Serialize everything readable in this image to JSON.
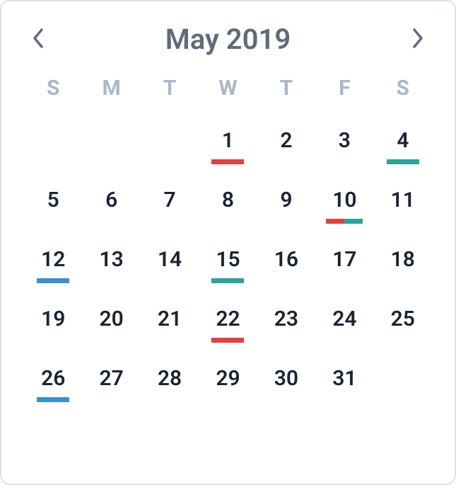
{
  "header": {
    "title": "May 2019"
  },
  "weekdays": [
    "S",
    "M",
    "T",
    "W",
    "T",
    "F",
    "S"
  ],
  "colors": {
    "red": "#e83e3e",
    "teal": "#26a69a",
    "blue": "#3b8fd6"
  },
  "days": [
    {
      "n": null
    },
    {
      "n": null
    },
    {
      "n": null
    },
    {
      "n": 1,
      "marks": [
        "red"
      ]
    },
    {
      "n": 2
    },
    {
      "n": 3
    },
    {
      "n": 4,
      "marks": [
        "teal"
      ]
    },
    {
      "n": 5
    },
    {
      "n": 6
    },
    {
      "n": 7
    },
    {
      "n": 8
    },
    {
      "n": 9
    },
    {
      "n": 10,
      "marks": [
        "red",
        "teal"
      ]
    },
    {
      "n": 11
    },
    {
      "n": 12,
      "marks": [
        "blue"
      ]
    },
    {
      "n": 13
    },
    {
      "n": 14
    },
    {
      "n": 15,
      "marks": [
        "teal"
      ]
    },
    {
      "n": 16
    },
    {
      "n": 17
    },
    {
      "n": 18
    },
    {
      "n": 19
    },
    {
      "n": 20
    },
    {
      "n": 21
    },
    {
      "n": 22,
      "marks": [
        "red"
      ]
    },
    {
      "n": 23
    },
    {
      "n": 24
    },
    {
      "n": 25
    },
    {
      "n": 26,
      "marks": [
        "blue"
      ]
    },
    {
      "n": 27
    },
    {
      "n": 28
    },
    {
      "n": 29
    },
    {
      "n": 30
    },
    {
      "n": 31
    },
    {
      "n": null
    }
  ]
}
